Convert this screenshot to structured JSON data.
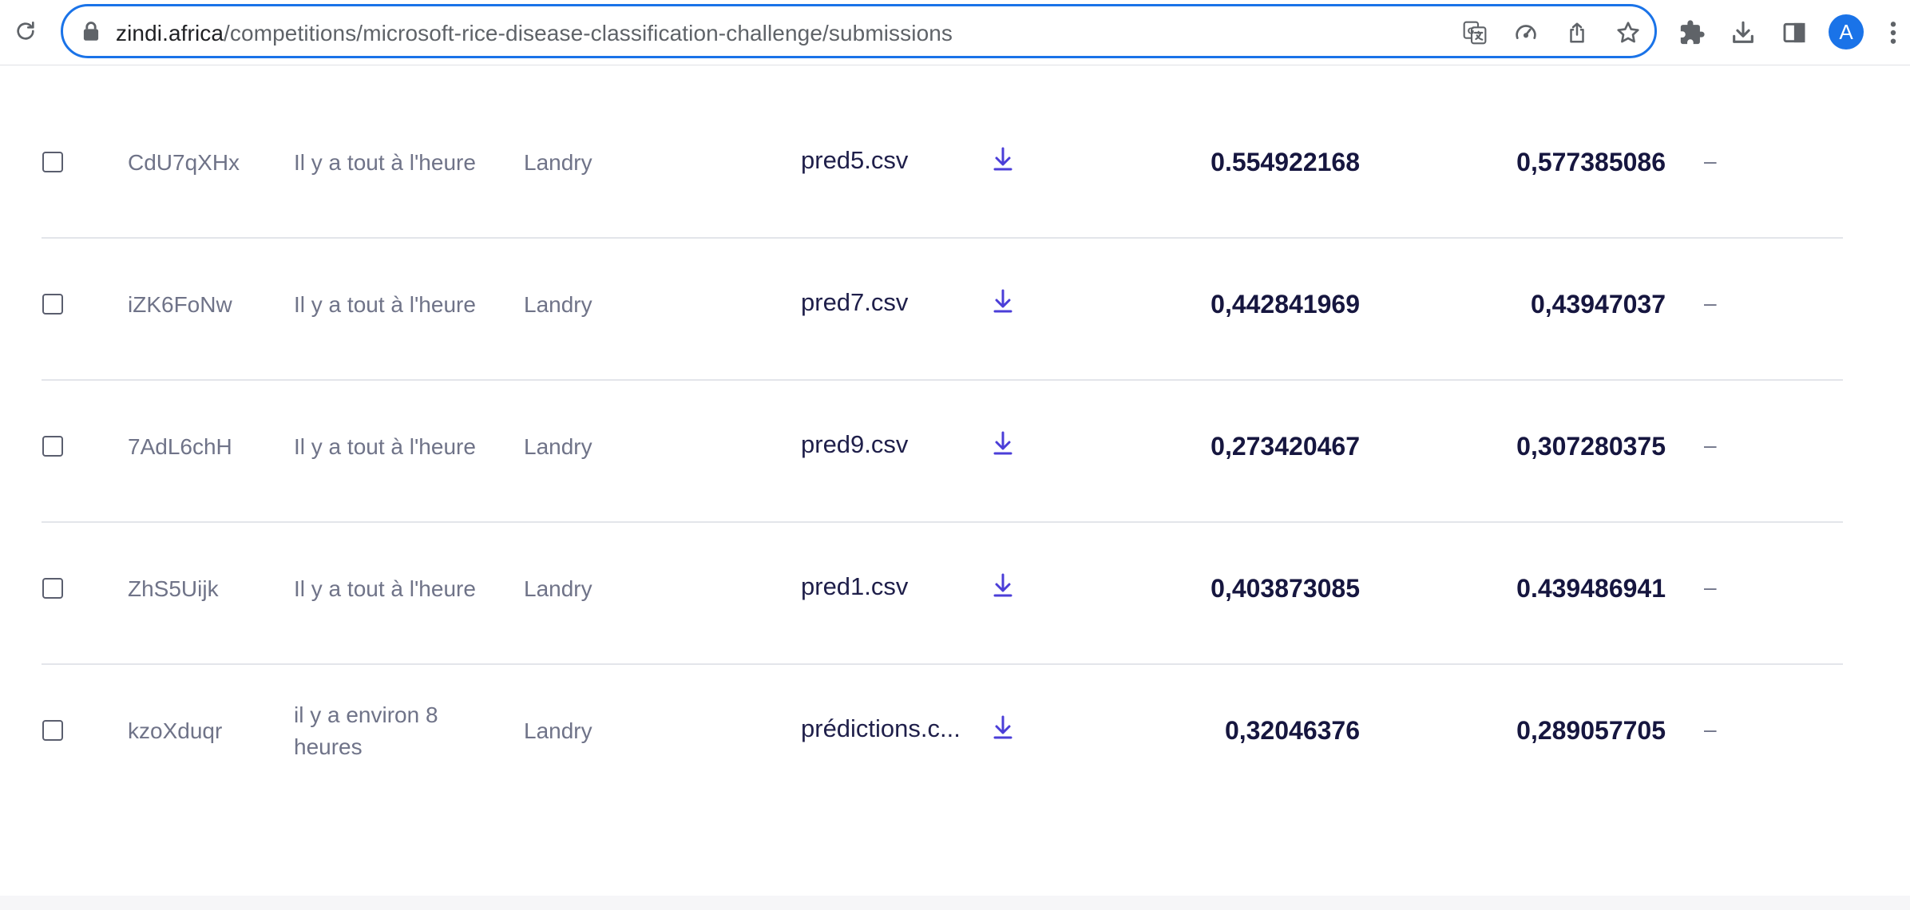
{
  "browser": {
    "url_host": "zindi.africa",
    "url_path": "/competitions/microsoft-rice-disease-classification-challenge/submissions",
    "profile_initial": "A",
    "accent_color": "#1a73e8"
  },
  "icons": {
    "reload": "reload-icon",
    "lock": "lock-icon",
    "translate": "translate-icon",
    "performance": "performance-icon",
    "share": "share-icon",
    "bookmark": "star-icon",
    "extensions": "puzzle-icon",
    "downloads": "download-icon",
    "side_panel": "side-panel-icon",
    "menu": "kebab-menu-icon",
    "file_download": "download-arrow-icon"
  },
  "submissions": [
    {
      "id": "CdU7qXHx",
      "time": "Il y a tout à l'heure",
      "user": "Landry",
      "file": "pred5.csv",
      "public_score": "0.554922168",
      "private_score": "0,577385086",
      "status": "–"
    },
    {
      "id": "iZK6FoNw",
      "time": "Il y a tout à l'heure",
      "user": "Landry",
      "file": "pred7.csv",
      "public_score": "0,442841969",
      "private_score": "0,43947037",
      "status": "–"
    },
    {
      "id": "7AdL6chH",
      "time": "Il y a tout à l'heure",
      "user": "Landry",
      "file": "pred9.csv",
      "public_score": "0,273420467",
      "private_score": "0,307280375",
      "status": "–"
    },
    {
      "id": "ZhS5Uijk",
      "time": "Il y a tout à l'heure",
      "user": "Landry",
      "file": "pred1.csv",
      "public_score": "0,403873085",
      "private_score": "0.439486941",
      "status": "–"
    },
    {
      "id": "kzoXduqr",
      "time": "il y a environ 8 heures",
      "user": "Landry",
      "file": "prédictions.c...",
      "public_score": "0,32046376",
      "private_score": "0,289057705",
      "status": "–"
    }
  ],
  "colors": {
    "score_text": "#16163f",
    "muted_text": "#6f7388",
    "download_link": "#4b3ed8"
  }
}
